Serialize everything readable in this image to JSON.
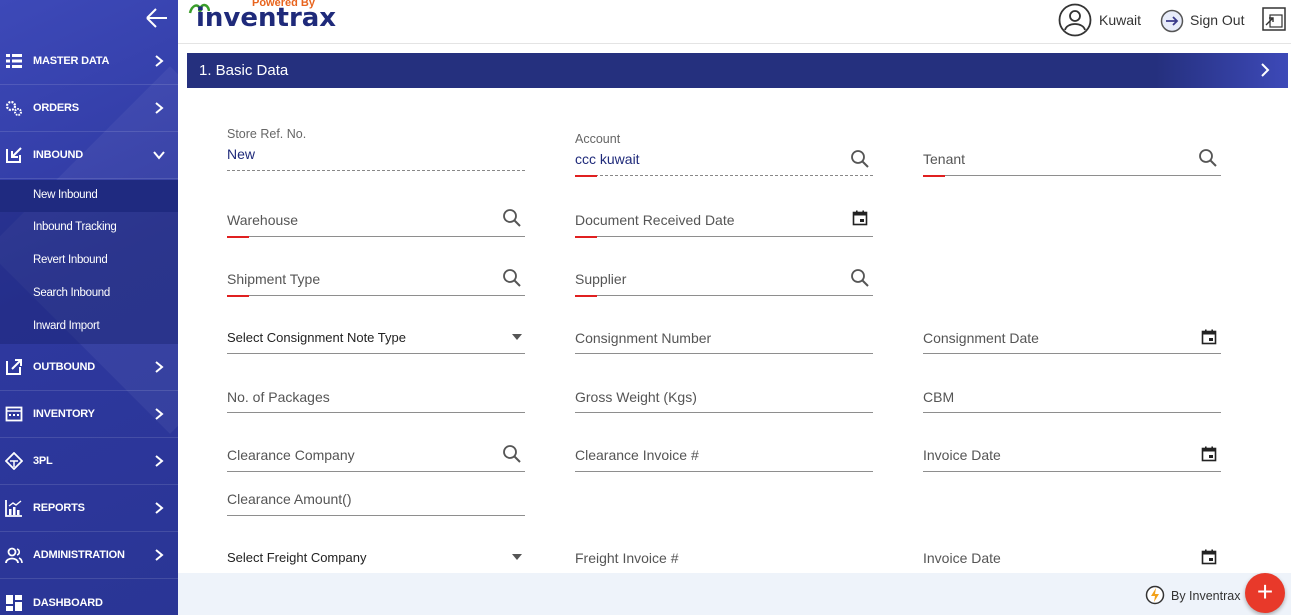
{
  "header": {
    "powered_by": "Powered By",
    "brand": "inventrax",
    "user": "Kuwait",
    "sign_out": "Sign Out"
  },
  "sidebar": {
    "menu": [
      {
        "label": "MASTER DATA",
        "icon": "list-icon"
      },
      {
        "label": "ORDERS",
        "icon": "gears-icon"
      },
      {
        "label": "INBOUND",
        "icon": "inbound-icon",
        "expanded": true
      },
      {
        "label": "OUTBOUND",
        "icon": "outbound-icon"
      },
      {
        "label": "INVENTORY",
        "icon": "inventory-icon"
      },
      {
        "label": "3PL",
        "icon": "3pl-icon"
      },
      {
        "label": "REPORTS",
        "icon": "reports-icon"
      },
      {
        "label": "ADMINISTRATION",
        "icon": "administration-icon"
      },
      {
        "label": "DASHBOARD",
        "icon": "dashboard-icon"
      }
    ],
    "inbound_sub": [
      {
        "label": "New Inbound",
        "active": true
      },
      {
        "label": "Inbound Tracking"
      },
      {
        "label": "Revert Inbound"
      },
      {
        "label": "Search Inbound"
      },
      {
        "label": "Inward Import"
      }
    ]
  },
  "section": {
    "title": "1. Basic Data"
  },
  "form": {
    "store_ref_label": "Store Ref. No.",
    "store_ref_value": "New",
    "account_label": "Account",
    "account_value": "ccc kuwait",
    "tenant": "Tenant",
    "warehouse": "Warehouse",
    "doc_received_date": "Document Received Date",
    "shipment_type": "Shipment Type",
    "supplier": "Supplier",
    "consignment_note_type": "Select Consignment Note Type",
    "consignment_number": "Consignment Number",
    "consignment_date": "Consignment Date",
    "no_of_packages": "No. of Packages",
    "gross_weight": "Gross Weight (Kgs)",
    "cbm": "CBM",
    "clearance_company": "Clearance Company",
    "clearance_invoice": "Clearance Invoice #",
    "invoice_date_1": "Invoice Date",
    "clearance_amount": "Clearance Amount()",
    "freight_company": "Select Freight Company",
    "freight_invoice": "Freight Invoice #",
    "invoice_date_2": "Invoice Date"
  },
  "footer": {
    "by": "By Inventrax",
    "fab": "+"
  },
  "colors": {
    "sidebar": "#2e389f",
    "section_bar": "#25307e",
    "required": "#e02020",
    "fab": "#e8392a"
  }
}
